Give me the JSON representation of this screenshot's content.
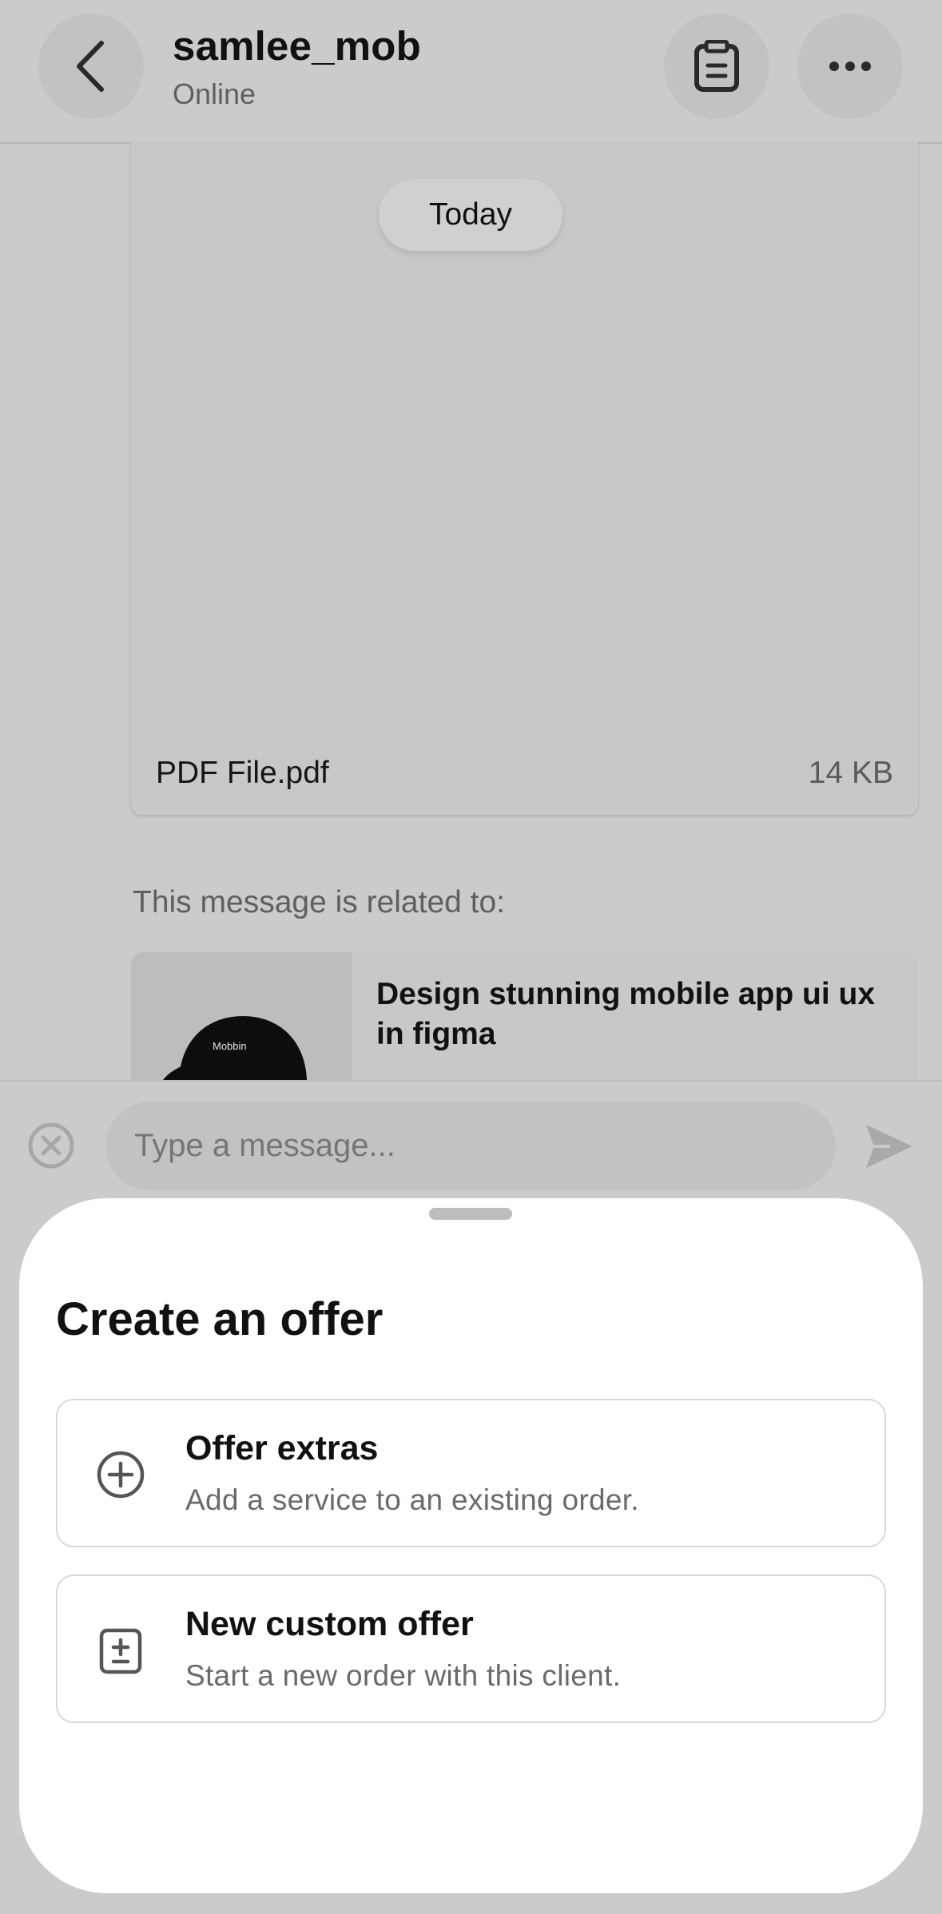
{
  "header": {
    "username": "samlee_mob",
    "status": "Online",
    "back_icon": "chevron-left-icon",
    "clipboard_icon": "clipboard-icon",
    "more_icon": "more-horizontal-icon"
  },
  "chat": {
    "date_separator": "Today",
    "attachment": {
      "file_name": "PDF File.pdf",
      "file_size": "14 KB"
    },
    "related_label": "This message is related to:",
    "related_gig": {
      "title": "Design stunning mobile app ui ux in figma",
      "thumbnail_text": "Mobbin"
    }
  },
  "composer": {
    "placeholder": "Type a message...",
    "close_icon": "close-circle-icon",
    "send_icon": "send-icon"
  },
  "sheet": {
    "title": "Create an offer",
    "options": [
      {
        "title": "Offer extras",
        "description": "Add a service to an existing order.",
        "icon": "plus-circle-icon"
      },
      {
        "title": "New custom offer",
        "description": "Start a new order with this client.",
        "icon": "clipboard-plus-minus-icon"
      }
    ]
  },
  "colors": {
    "overlay_background": "#cbcbcb",
    "sheet_background": "#ffffff",
    "primary_text": "#111111",
    "secondary_text": "#6a6a6a"
  }
}
